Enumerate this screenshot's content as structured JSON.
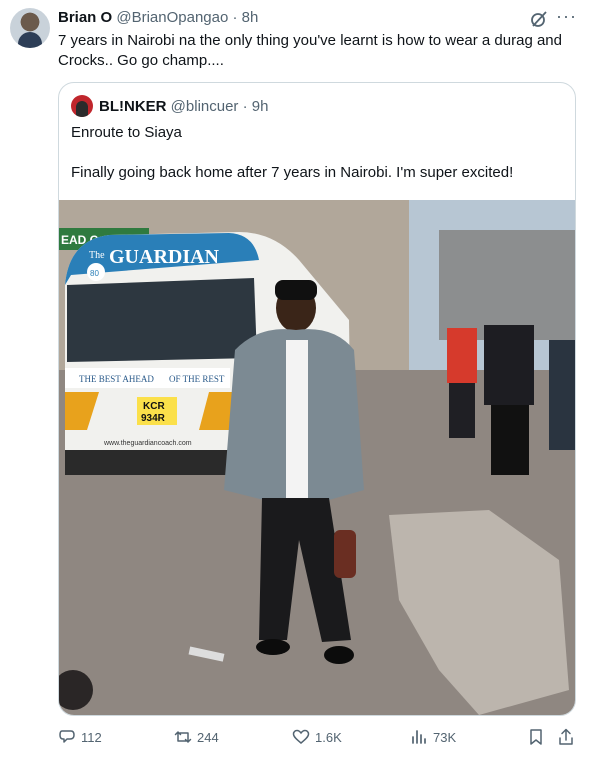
{
  "tweet": {
    "author_name": "Brian O",
    "handle": "@BrianOpangao",
    "separator": "·",
    "time": "8h",
    "text_line1": "7 years in Nairobi na the only thing you've learnt is how to wear a durag and",
    "text_line2": "Crocks.. Go go champ....",
    "more_label": "···"
  },
  "quote": {
    "author_name": "BL!NKER",
    "handle": "@blincuer",
    "separator": "·",
    "time": "9h",
    "line1": "Enroute to Siaya",
    "line2": "Finally going back home after 7 years in Nairobi. I'm super excited!",
    "photo": {
      "van_brand": "GUARDIAN",
      "van_brand_small": "The",
      "van_badge": "80",
      "van_slogan_left": "THE BEST AHEAD",
      "van_slogan_right": "OF THE REST",
      "plate_line1": "KCR",
      "plate_line2": "934R",
      "van_website": "www.theguardiancoach.com",
      "sign_fragment": "EAD C"
    }
  },
  "actions": {
    "replies": "112",
    "reposts": "244",
    "likes": "1.6K",
    "views": "73K"
  },
  "icons": [
    "grok-icon",
    "more-icon",
    "reply-icon",
    "repost-icon",
    "like-icon",
    "views-icon",
    "bookmark-icon",
    "share-icon"
  ],
  "colors": {
    "muted": "#536471",
    "border": "#cfd9de",
    "van_blue": "#2a7fb8",
    "van_stripe": "#e8a21c"
  }
}
